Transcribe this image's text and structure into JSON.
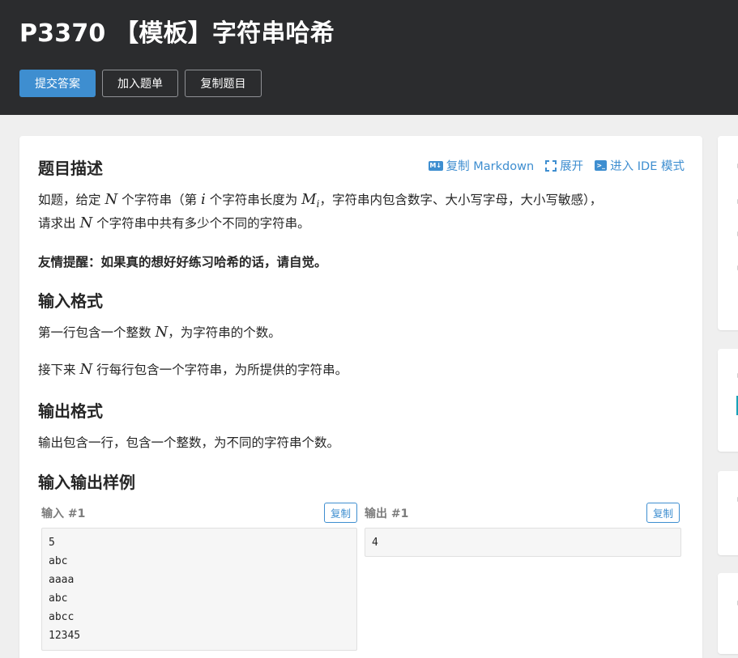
{
  "header": {
    "title": "P3370 【模板】字符串哈希",
    "buttons": {
      "submit": "提交答案",
      "add_to_list": "加入题单",
      "copy_problem": "复制题目"
    }
  },
  "toolbar": {
    "copy_markdown": "复制 Markdown",
    "expand": "展开",
    "enter_ide": "进入 IDE 模式"
  },
  "description": {
    "heading": "题目描述",
    "line1_parts": [
      "如题，给定 ",
      "N",
      " 个字符串（第 ",
      "i",
      " 个字符串长度为 ",
      "M",
      "i",
      "，字符串内包含数字、大小写字母，大小写敏感），"
    ],
    "line2_parts": [
      "请求出 ",
      "N",
      " 个字符串中共有多少个不同的字符串。"
    ],
    "tip": "友情提醒：如果真的想好好练习哈希的话，请自觉。"
  },
  "input_format": {
    "heading": "输入格式",
    "line1_parts": [
      "第一行包含一个整数 ",
      "N",
      "，为字符串的个数。"
    ],
    "line2_parts": [
      "接下来 ",
      "N",
      " 行每行包含一个字符串，为所提供的字符串。"
    ]
  },
  "output_format": {
    "heading": "输出格式",
    "line1": "输出包含一行，包含一个整数，为不同的字符串个数。"
  },
  "samples": {
    "heading": "输入输出样例",
    "input_label": "输入 #1",
    "output_label": "输出 #1",
    "copy_label": "复制",
    "input_lines": [
      "5",
      "abc",
      "aaaa",
      "abc",
      "abcc",
      "12345"
    ],
    "output_lines": [
      "4"
    ]
  },
  "colors": {
    "header_bg": "#2b2c2e",
    "accent": "#3e8ed0",
    "page_bg": "#efefef"
  },
  "icons": {
    "markdown": "markdown-icon",
    "expand": "expand-icon",
    "ide": "terminal-icon"
  }
}
